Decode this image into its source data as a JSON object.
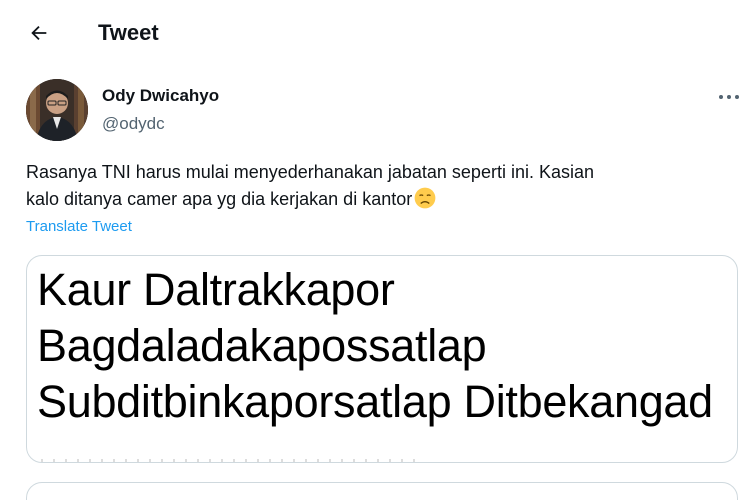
{
  "header": {
    "title": "Tweet"
  },
  "author": {
    "name": "Ody Dwicahyo",
    "handle": "@odydc"
  },
  "tweet": {
    "text_line1": "Rasanya TNI harus mulai menyederhanakan jabatan seperti ini. Kasian",
    "text_line2": "kalo ditanya camer apa yg dia kerjakan di kantor",
    "emoji": "disappointed-face",
    "translate_label": "Translate Tweet"
  },
  "media": {
    "lines": [
      "Kaur Daltrakkapor",
      "Bagdaladakapossatlap",
      "Subditbinkaporsatlap Ditbekangad"
    ]
  },
  "colors": {
    "link": "#1d9bf0",
    "secondary_text": "#536471",
    "border": "#cfd9de"
  }
}
